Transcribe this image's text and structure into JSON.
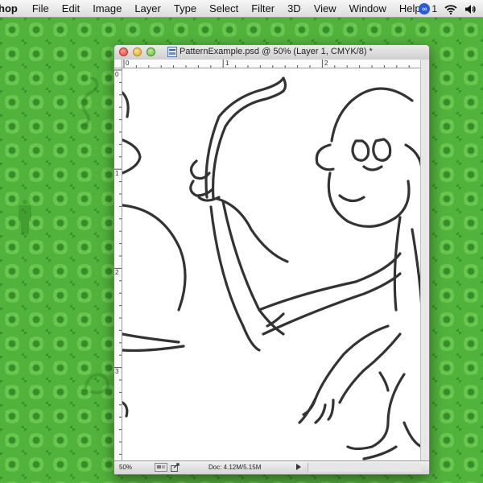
{
  "menubar": {
    "app_name": "hop",
    "items": [
      "File",
      "Edit",
      "Image",
      "Layer",
      "Type",
      "Select",
      "Filter",
      "3D",
      "View",
      "Window",
      "Help"
    ],
    "cc_count": "1",
    "icons": [
      "creative-cloud-icon",
      "wifi-icon",
      "volume-icon"
    ]
  },
  "window": {
    "title": "PatternExample.psd @ 50% (Layer 1, CMYK/8) *",
    "ruler_top": [
      "0",
      "1",
      "2"
    ],
    "ruler_left": [
      "0",
      "1",
      "2",
      "3"
    ]
  },
  "status": {
    "zoom": "50%",
    "doc_info": "Doc: 4.12M/5.15M"
  },
  "colors": {
    "desktop_green": "#52b33c",
    "close": "#e0453c",
    "minimize": "#e2a82b",
    "zoom": "#5eb83a"
  }
}
